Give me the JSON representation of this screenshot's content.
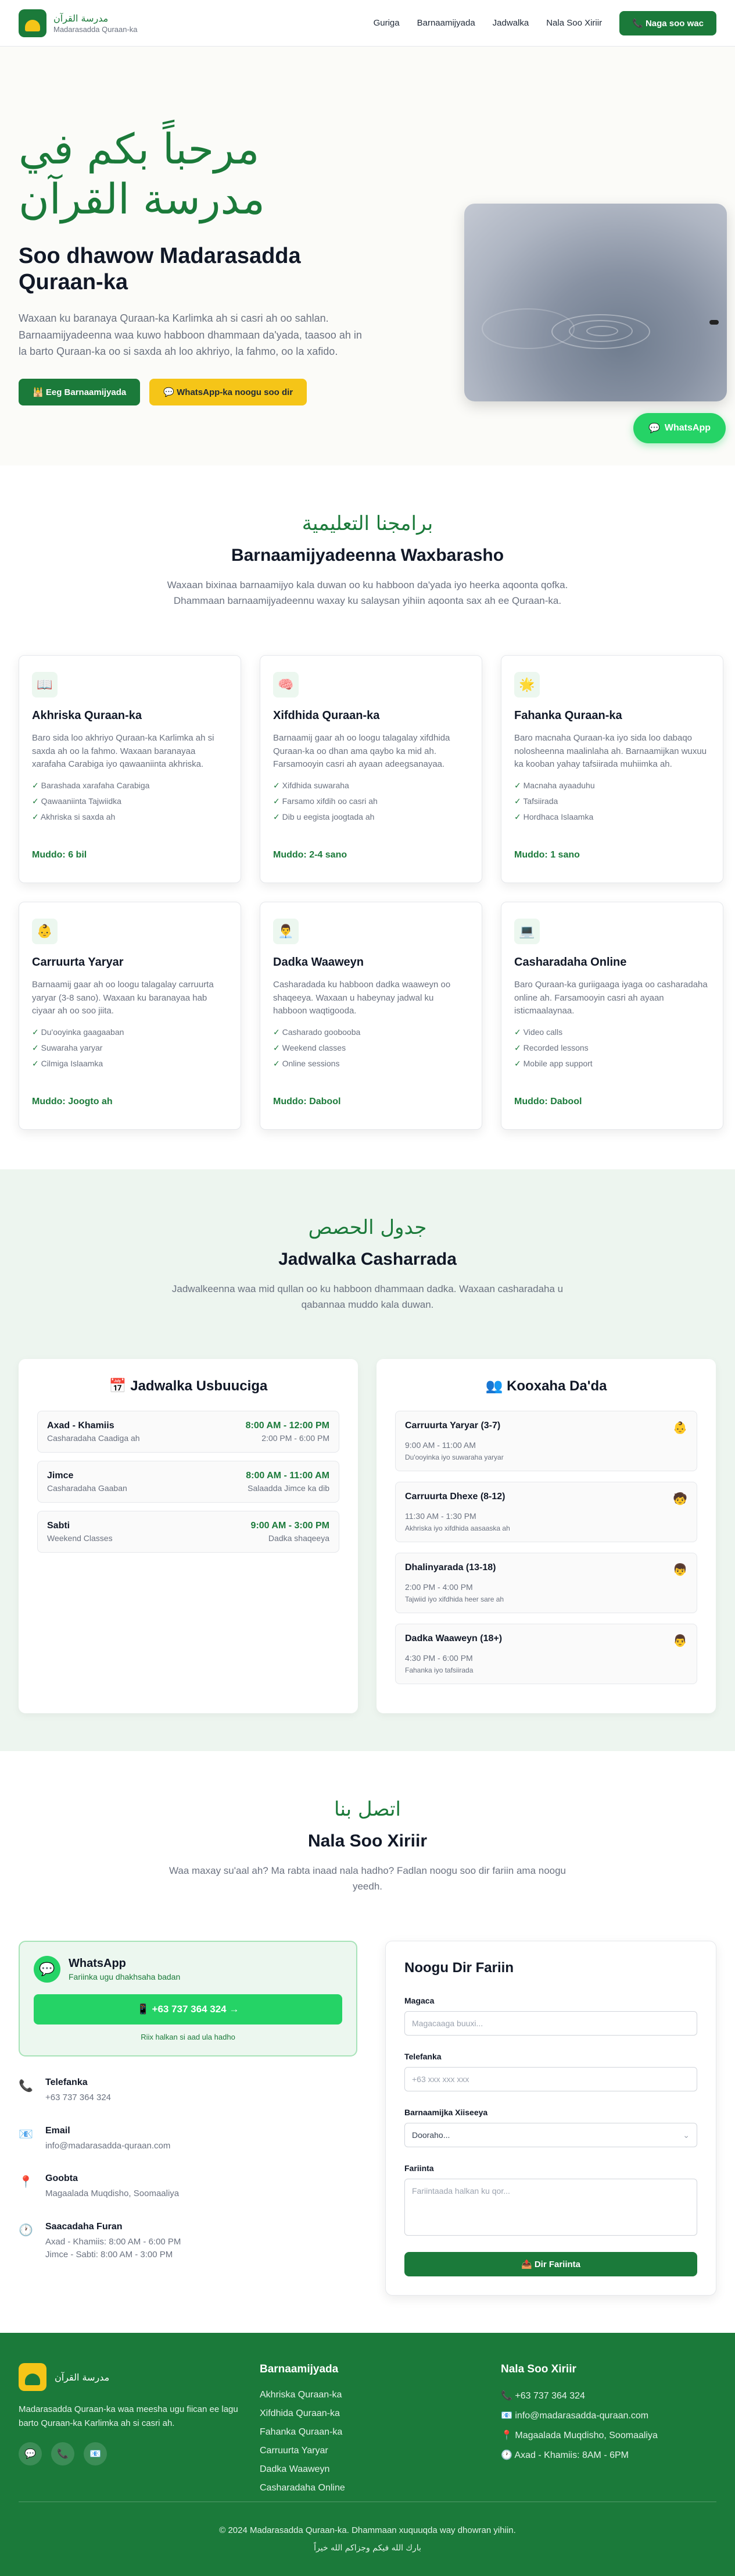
{
  "nav": {
    "brand_ar": "مدرسة القرآن",
    "brand_sub": "Madarasadda Quraan-ka",
    "links": [
      "Guriga",
      "Barnaamijyada",
      "Jadwalka",
      "Nala Soo Xiriir"
    ],
    "cta": "Naga soo wac"
  },
  "hero": {
    "ar_title": "مرحباً بكم في مدرسة القرآن",
    "title": "Soo dhawow Madarasadda Quraan-ka",
    "desc": "Waxaan ku baranaya Quraan-ka Karlimka ah si casri ah oo sahlan. Barnaamijyadeenna waa kuwo habboon dhammaan da'yada, taasoo ah in la barto Quraan-ka oo si saxda ah loo akhriyo, la fahmo, oo la xafido.",
    "btn_programs": "Eeg Barnaamijyada",
    "btn_whatsapp": "WhatsApp-ka noogu soo dir",
    "float_whatsapp": "WhatsApp"
  },
  "programs": {
    "ar_title": "برامجنا التعليمية",
    "title": "Barnaamijyadeenna Waxbarasho",
    "desc": "Waxaan bixinaa barnaamijyo kala duwan oo ku habboon da'yada iyo heerka aqoonta qofka. Dhammaan barnaamijyadeennu waxay ku salaysan yihiin aqoonta sax ah ee Quraan-ka.",
    "cards": [
      {
        "icon": "📖",
        "icon_name": "book-icon",
        "title": "Akhriska Quraan-ka",
        "desc": "Baro sida loo akhriyo Quraan-ka Karlimka ah si saxda ah oo la fahmo. Waxaan baranayaa xarafaha Carabiga iyo qawaaniinta akhriska.",
        "items": [
          "Barashada xarafaha Carabiga",
          "Qawaaniinta Tajwiidka",
          "Akhriska si saxda ah"
        ],
        "duration": "Muddo: 6 bil"
      },
      {
        "icon": "🧠",
        "icon_name": "brain-icon",
        "title": "Xifdhida Quraan-ka",
        "desc": "Barnaamij gaar ah oo loogu talagalay xifdhida Quraan-ka oo dhan ama qaybo ka mid ah. Farsamooyin casri ah ayaan adeegsanayaa.",
        "items": [
          "Xifdhida suwaraha",
          "Farsamo xifdih oo casri ah",
          "Dib u eegista joogtada ah"
        ],
        "duration": "Muddo: 2-4 sano"
      },
      {
        "icon": "🌟",
        "icon_name": "star-icon",
        "title": "Fahanka Quraan-ka",
        "desc": "Baro macnaha Quraan-ka iyo sida loo dabaqo nolosheenna maalinlaha ah. Barnaamijkan wuxuu ka kooban yahay tafsiirada muhiimka ah.",
        "items": [
          "Macnaha ayaaduhu",
          "Tafsiirada",
          "Hordhaca Islaamka"
        ],
        "duration": "Muddo: 1 sano"
      },
      {
        "icon": "👶",
        "icon_name": "baby-icon",
        "title": "Carruurta Yaryar",
        "desc": "Barnaamij gaar ah oo loogu talagalay carruurta yaryar (3-8 sano). Waxaan ku baranayaa hab ciyaar ah oo soo jiita.",
        "items": [
          "Du'ooyinka gaagaaban",
          "Suwaraha yaryar",
          "Cilmiga Islaamka"
        ],
        "duration": "Muddo: Joogto ah"
      },
      {
        "icon": "👨‍💼",
        "icon_name": "adult-icon",
        "title": "Dadka Waaweyn",
        "desc": "Casharadada ku habboon dadka waaweyn oo shaqeeya. Waxaan u habeynay jadwal ku habboon waqtigooda.",
        "items": [
          "Casharado goobooba",
          "Weekend classes",
          "Online sessions"
        ],
        "duration": "Muddo: Dabool"
      },
      {
        "icon": "💻",
        "icon_name": "laptop-icon",
        "title": "Casharadaha Online",
        "desc": "Baro Quraan-ka guriigaaga iyaga oo casharadaha online ah. Farsamooyin casri ah ayaan isticmaalaynaa.",
        "items": [
          "Video calls",
          "Recorded lessons",
          "Mobile app support"
        ],
        "duration": "Muddo: Dabool"
      }
    ]
  },
  "schedule": {
    "ar_title": "جدول الحصص",
    "title": "Jadwalka Casharrada",
    "desc": "Jadwalkeenna waa mid qullan oo ku habboon dhammaan dadka. Waxaan casharadaha u qabannaa muddo kala duwan.",
    "weekly_title": "Jadwalka Usbuuciga",
    "weekly_icon": "📅",
    "weekly": [
      {
        "day": "Axad - Khamiis",
        "sub": "Casharadaha Caadiga ah",
        "time": "8:00 AM - 12:00 PM",
        "time2": "2:00 PM - 6:00 PM"
      },
      {
        "day": "Jimce",
        "sub": "Casharadaha Gaaban",
        "time": "8:00 AM - 11:00 AM",
        "time2": "Salaadda Jimce ka dib"
      },
      {
        "day": "Sabti",
        "sub": "Weekend Classes",
        "time": "9:00 AM - 3:00 PM",
        "time2": "Dadka shaqeeya"
      }
    ],
    "groups_title": "Kooxaha Da'da",
    "groups_icon": "👥",
    "groups": [
      {
        "name": "Carruurta Yaryar (3-7)",
        "time": "9:00 AM - 11:00 AM",
        "desc": "Du'ooyinka iyo suwaraha yaryar",
        "emoji": "👶"
      },
      {
        "name": "Carruurta Dhexe (8-12)",
        "time": "11:30 AM - 1:30 PM",
        "desc": "Akhriska iyo xifdhida aasaaska ah",
        "emoji": "🧒"
      },
      {
        "name": "Dhalinyarada (13-18)",
        "time": "2:00 PM - 4:00 PM",
        "desc": "Tajwiid iyo xifdhida heer sare ah",
        "emoji": "👦"
      },
      {
        "name": "Dadka Waaweyn (18+)",
        "time": "4:30 PM - 6:00 PM",
        "desc": "Fahanka iyo tafsiirada",
        "emoji": "👨"
      }
    ]
  },
  "contact": {
    "ar_title": "اتصل بنا",
    "title": "Nala Soo Xiriir",
    "desc": "Waa maxay su'aal ah? Ma rabta inaad nala hadho? Fadlan noogu soo dir fariin ama noogu yeedh.",
    "wa_title": "WhatsApp",
    "wa_sub": "Fariinka ugu dhakhsaha badan",
    "wa_btn": "📱 +63 737 364 324 →",
    "wa_note": "Riix halkan si aad ula hadho",
    "info": [
      {
        "icon": "📞",
        "icon_name": "phone-icon",
        "title": "Telefanka",
        "value": "+63 737 364 324"
      },
      {
        "icon": "📧",
        "icon_name": "email-icon",
        "title": "Email",
        "value": "info@madarasadda-quraan.com"
      },
      {
        "icon": "📍",
        "icon_name": "location-icon",
        "title": "Goobta",
        "value": "Magaalada Muqdisho, Soomaaliya"
      },
      {
        "icon": "🕐",
        "icon_name": "clock-icon",
        "title": "Saacadaha Furan",
        "value": "Axad - Khamiis: 8:00 AM - 6:00 PM",
        "value2": "Jimce - Sabti: 8:00 AM - 3:00 PM"
      }
    ],
    "form": {
      "title": "Noogu Dir Fariin",
      "name_label": "Magaca",
      "name_placeholder": "Magacaaga buuxi...",
      "phone_label": "Telefanka",
      "phone_placeholder": "+63 xxx xxx xxx",
      "program_label": "Barnaamijka Xiiseeya",
      "program_value": "Dooraho...",
      "message_label": "Fariinta",
      "message_placeholder": "Fariintaada halkan ku qor...",
      "submit": "📤 Dir Fariinta"
    }
  },
  "footer": {
    "brand_ar": "مدرسة القرآن",
    "desc": "Madarasadda Quraan-ka waa meesha ugu fiican ee lagu barto Quraan-ka Karlimka ah si casri ah.",
    "programs_title": "Barnaamijyada",
    "programs": [
      "Akhriska Quraan-ka",
      "Xifdhida Quraan-ka",
      "Fahanka Quraan-ka",
      "Carruurta Yaryar",
      "Dadka Waaweyn",
      "Casharadaha Online"
    ],
    "contact_title": "Nala Soo Xiriir",
    "contact": [
      "📞 +63 737 364 324",
      "📧 info@madarasadda-quraan.com",
      "📍 Magaalada Muqdisho, Soomaaliya",
      "🕐 Axad - Khamiis: 8AM - 6PM"
    ],
    "copyright": "© 2024 Madarasadda Quraan-ka. Dhammaan xuquuqda way dhowran yihiin.",
    "ar_blessing": "بارك الله فيكم وجزاكم الله خيراً"
  }
}
